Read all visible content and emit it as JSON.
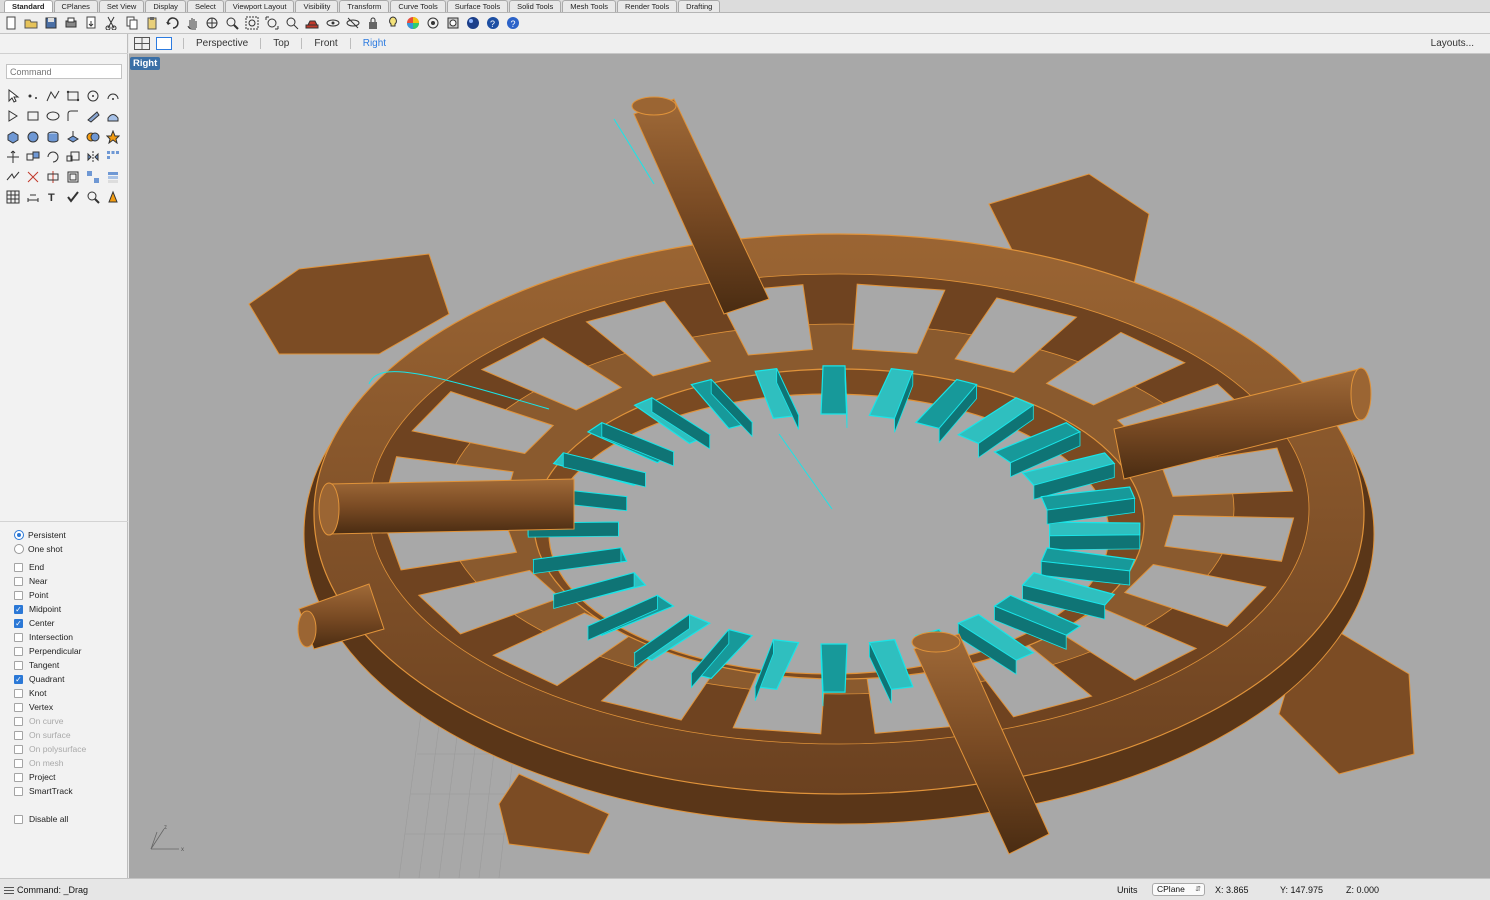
{
  "tabs": [
    "Standard",
    "CPlanes",
    "Set View",
    "Display",
    "Select",
    "Viewport Layout",
    "Visibility",
    "Transform",
    "Curve Tools",
    "Surface Tools",
    "Solid Tools",
    "Mesh Tools",
    "Render Tools",
    "Drafting"
  ],
  "active_tab": "Standard",
  "toolbar_icons": [
    "new-icon",
    "open-icon",
    "save-icon",
    "print-icon",
    "import-icon",
    "cut-icon",
    "copy-icon",
    "paste-icon",
    "undo-icon",
    "pan-icon",
    "rotate-view-icon",
    "zoom-icon",
    "zoom-window-icon",
    "zoom-extents-icon",
    "zoom-selected-icon",
    "car-icon",
    "hide-icon",
    "show-icon",
    "lock-icon",
    "light-icon",
    "color-wheel-icon",
    "grid-icon",
    "render-preview-icon",
    "rendered-icon",
    "render-icon",
    "help-icon"
  ],
  "command": {
    "placeholder": "Command"
  },
  "viewport_tabs": {
    "tabs": [
      "Perspective",
      "Top",
      "Front",
      "Right"
    ],
    "active": "Right",
    "layouts": "Layouts..."
  },
  "viewport": {
    "label": "Right"
  },
  "snap_mode": {
    "persistent": "Persistent",
    "one_shot": "One shot"
  },
  "osnaps": [
    {
      "label": "End",
      "checked": false,
      "enabled": true
    },
    {
      "label": "Near",
      "checked": false,
      "enabled": true
    },
    {
      "label": "Point",
      "checked": false,
      "enabled": true
    },
    {
      "label": "Midpoint",
      "checked": true,
      "enabled": true
    },
    {
      "label": "Center",
      "checked": true,
      "enabled": true
    },
    {
      "label": "Intersection",
      "checked": false,
      "enabled": true
    },
    {
      "label": "Perpendicular",
      "checked": false,
      "enabled": true
    },
    {
      "label": "Tangent",
      "checked": false,
      "enabled": true
    },
    {
      "label": "Quadrant",
      "checked": true,
      "enabled": true
    },
    {
      "label": "Knot",
      "checked": false,
      "enabled": true
    },
    {
      "label": "Vertex",
      "checked": false,
      "enabled": true
    },
    {
      "label": "On curve",
      "checked": false,
      "enabled": false
    },
    {
      "label": "On surface",
      "checked": false,
      "enabled": false
    },
    {
      "label": "On polysurface",
      "checked": false,
      "enabled": false
    },
    {
      "label": "On mesh",
      "checked": false,
      "enabled": false
    },
    {
      "label": "Project",
      "checked": false,
      "enabled": true
    },
    {
      "label": "SmartTrack",
      "checked": false,
      "enabled": true
    }
  ],
  "disable_all": "Disable all",
  "status": {
    "command": "Command: _Drag",
    "units": "Units",
    "cplane": "CPlane",
    "x": "X: 3.865",
    "y": "Y: 147.975",
    "z": "Z: 0.000"
  },
  "colors": {
    "wood": "#8a5a2e",
    "wood_dark": "#4e2f14",
    "wire": "#e0933a",
    "fin": "#1fa9a8",
    "fin_edge": "#19e5e8",
    "viewport_bg": "#a8a8a8",
    "accent": "#2c7be0"
  }
}
